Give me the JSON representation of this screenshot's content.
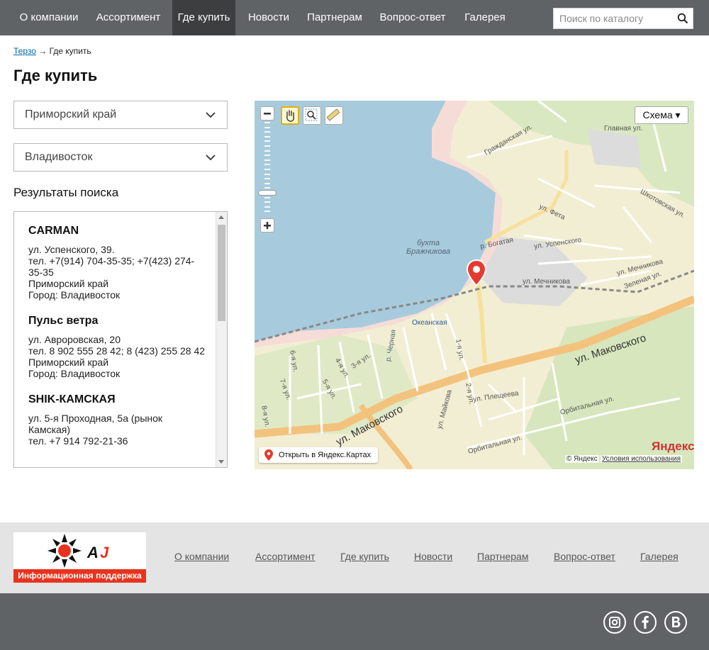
{
  "nav": {
    "items": [
      {
        "label": "О компании"
      },
      {
        "label": "Ассортимент"
      },
      {
        "label": "Где купить",
        "active": true
      },
      {
        "label": "Новости"
      },
      {
        "label": "Партнерам"
      },
      {
        "label": "Вопрос-ответ"
      },
      {
        "label": "Галерея"
      }
    ],
    "search_placeholder": "Поиск по каталогу"
  },
  "breadcrumb": {
    "home": "Терзо",
    "separator": " → ",
    "current": "Где купить"
  },
  "page_title": "Где купить",
  "filters": {
    "region": "Приморский край",
    "city": "Владивосток"
  },
  "results": {
    "title": "Результаты поиска",
    "items": [
      {
        "name": "CARMAN",
        "address": "ул. Успенского, 39.",
        "phone": "тел. +7(914) 704-35-35; +7(423) 274-35-35",
        "region": "Приморский край",
        "city": "Город: Владивосток"
      },
      {
        "name": "Пульс ветра",
        "address": "ул. Авроровская, 20",
        "phone": "тел. 8 902 555 28 42; 8 (423) 255 28 42",
        "region": "Приморский край",
        "city": "Город: Владивосток"
      },
      {
        "name": "SHIK-КАМСКАЯ",
        "address": "ул. 5-я Проходная, 5а (рынок Камская)",
        "phone": "тел. +7 914 792-21-36",
        "region": "",
        "city": ""
      }
    ]
  },
  "map": {
    "scheme_label": "Схема ▾",
    "open_label": "Открыть в Яндекс.Картах",
    "logo": "Яндекс",
    "copyright": "© Яндекс",
    "terms": "Условия использования",
    "labels": {
      "makovskogo1": "ул. Маковского",
      "makovskogo2": "ул. Маковского",
      "bay": "бухта\nБражникова",
      "station": "Океанская",
      "glavnaya": "Главная ул.",
      "grazhdanskaya": "Гражданская ул.",
      "shkotovskaya": "Шкотовская ул.",
      "feta": "ул. Фета",
      "bogataya": "р. Богатая",
      "uspenskogo": "ул. Успенского",
      "mechnikova1": "ул. Мечникова",
      "mechnikova2": "ул. Мечникова",
      "zelenaya": "Зеленая ул.",
      "plescheeva": "ул. Плещеева",
      "maykova": "ул. Майкова",
      "orbitalnaya1": "Орбитальная ул.",
      "orbitalnaya2": "Орбитальная ул.",
      "chernaya": "р. Черная",
      "u1": "1-я ул.",
      "u2": "2-я ул.",
      "u3": "3-я ул.",
      "u4": "4-я ул.",
      "u5": "5-я ул.",
      "u6": "6-я ул.",
      "u7": "7-я ул.",
      "u8": "8-я ул."
    }
  },
  "footer": {
    "logo_banner": "Информационная поддержка",
    "links": [
      {
        "label": "О компании"
      },
      {
        "label": "Ассортимент"
      },
      {
        "label": "Где купить"
      },
      {
        "label": "Новости"
      },
      {
        "label": "Партнерам"
      },
      {
        "label": "Вопрос-ответ"
      },
      {
        "label": "Галерея"
      }
    ]
  },
  "social": [
    "instagram-icon",
    "facebook-icon",
    "vk-icon"
  ]
}
